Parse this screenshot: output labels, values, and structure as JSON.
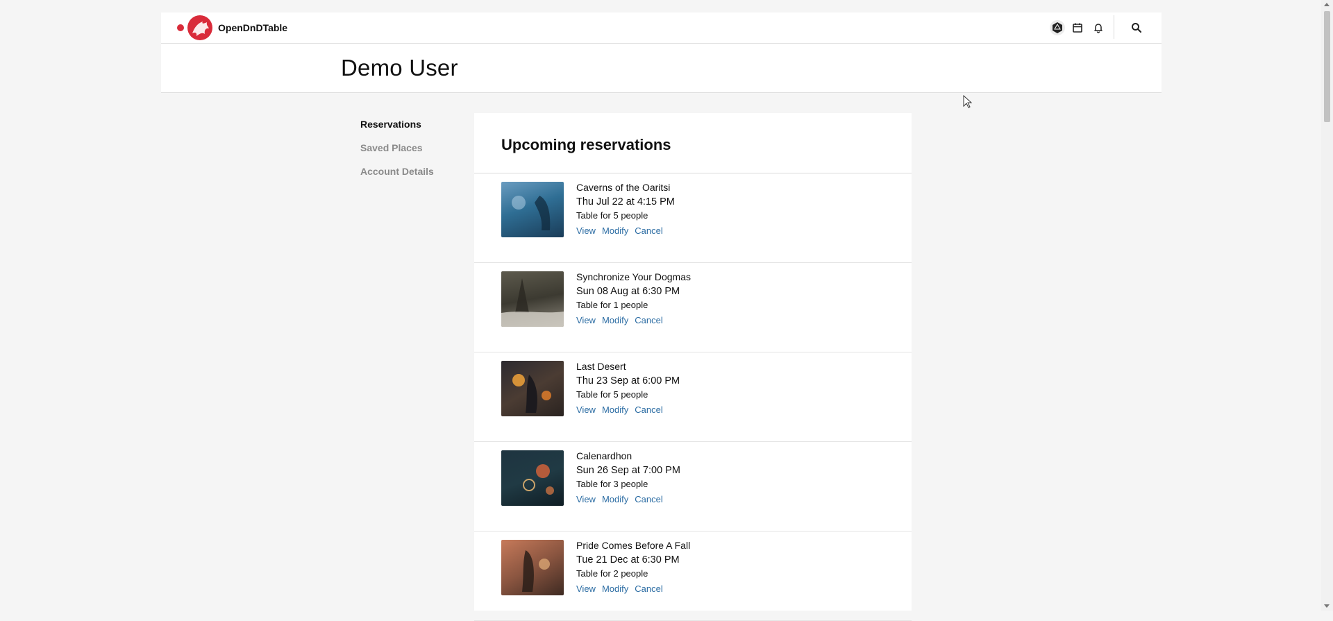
{
  "header": {
    "brand_name": "OpenDnDTable",
    "icons": [
      "d20-icon",
      "calendar-icon",
      "bell-icon",
      "search-icon"
    ]
  },
  "user": {
    "name": "Demo User"
  },
  "sidebar": {
    "items": [
      {
        "label": "Reservations",
        "active": true
      },
      {
        "label": "Saved Places",
        "active": false
      },
      {
        "label": "Account Details",
        "active": false
      }
    ]
  },
  "main": {
    "title": "Upcoming reservations",
    "reservations": [
      {
        "name": "Caverns of the Oaritsi",
        "date": "Thu Jul 22 at 4:15 PM",
        "table": "Table for 5 people",
        "actions": [
          "View",
          "Modify",
          "Cancel"
        ]
      },
      {
        "name": "Synchronize Your Dogmas",
        "date": "Sun 08 Aug at 6:30 PM",
        "table": "Table for 1 people",
        "actions": [
          "View",
          "Modify",
          "Cancel"
        ]
      },
      {
        "name": "Last Desert",
        "date": "Thu 23 Sep at 6:00 PM",
        "table": "Table for 5 people",
        "actions": [
          "View",
          "Modify",
          "Cancel"
        ]
      },
      {
        "name": "Calenardhon",
        "date": "Sun 26 Sep at 7:00 PM",
        "table": "Table for 3 people",
        "actions": [
          "View",
          "Modify",
          "Cancel"
        ]
      },
      {
        "name": "Pride Comes Before A Fall",
        "date": "Tue 21 Dec at 6:30 PM",
        "table": "Table for 2 people",
        "actions": [
          "View",
          "Modify",
          "Cancel"
        ]
      }
    ]
  },
  "colors": {
    "brand": "#d92b3a",
    "link": "#2b6ca3"
  }
}
